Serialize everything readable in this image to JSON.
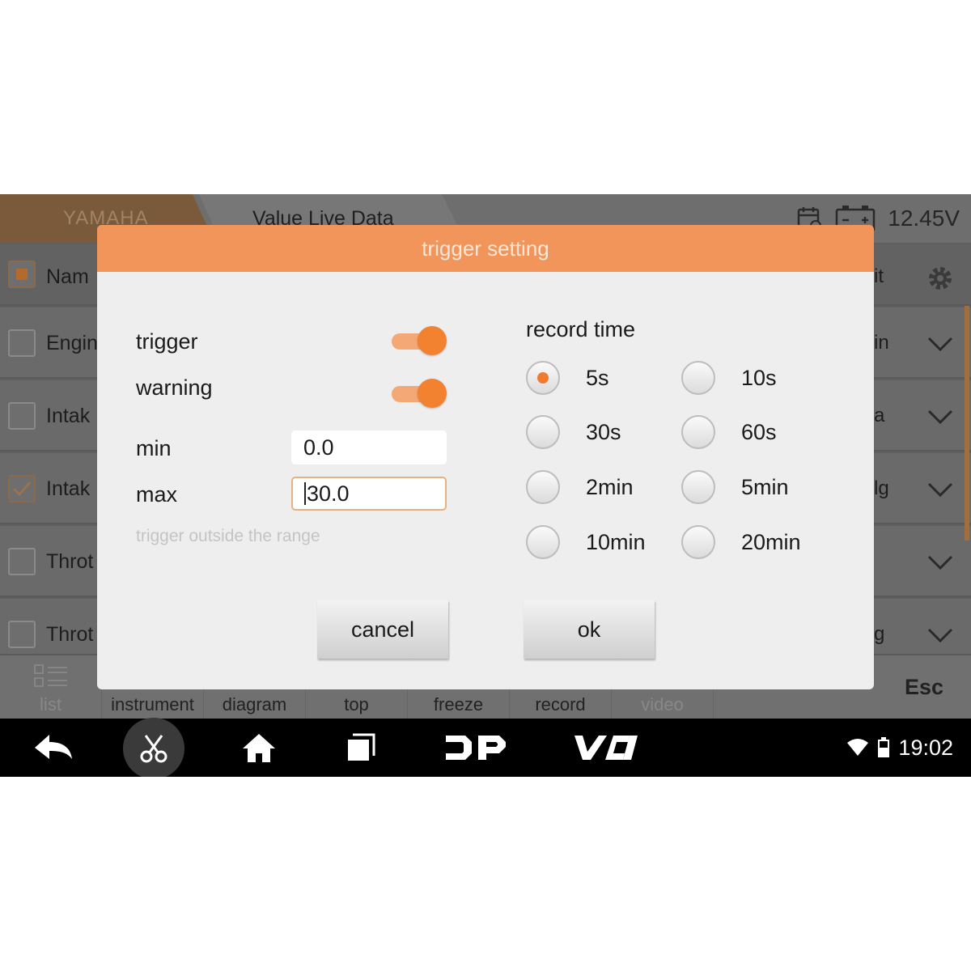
{
  "topbar": {
    "brand": "YAMAHA",
    "title": "Value Live Data",
    "voltage": "12.45V"
  },
  "list": {
    "header_name": "Nam",
    "header_unit": "it",
    "rows": [
      {
        "name": "Engin",
        "unit": "in",
        "checked": false
      },
      {
        "name": "Intak",
        "unit": "a",
        "checked": false
      },
      {
        "name": "Intak",
        "unit": "lg",
        "checked": true
      },
      {
        "name": "Throt",
        "unit": "",
        "checked": false
      },
      {
        "name": "Throt",
        "unit": "g",
        "checked": false
      }
    ]
  },
  "toolbar": {
    "list": "list",
    "instrument": "instrument",
    "diagram": "diagram",
    "top": "top",
    "freeze": "freeze",
    "record": "record",
    "video": "video",
    "esc": "Esc"
  },
  "navbar": {
    "time": "19:02"
  },
  "dialog": {
    "title": "trigger setting",
    "trigger_label": "trigger",
    "warning_label": "warning",
    "trigger_on": true,
    "warning_on": true,
    "min_label": "min",
    "min_value": "0.0",
    "max_label": "max",
    "max_value": "30.0",
    "hint": "trigger outside the range",
    "record_time_label": "record time",
    "options": [
      "5s",
      "10s",
      "30s",
      "60s",
      "2min",
      "5min",
      "10min",
      "20min"
    ],
    "selected_option": "5s",
    "cancel": "cancel",
    "ok": "ok"
  },
  "colors": {
    "accent": "#f28230",
    "header": "#f1955a"
  }
}
